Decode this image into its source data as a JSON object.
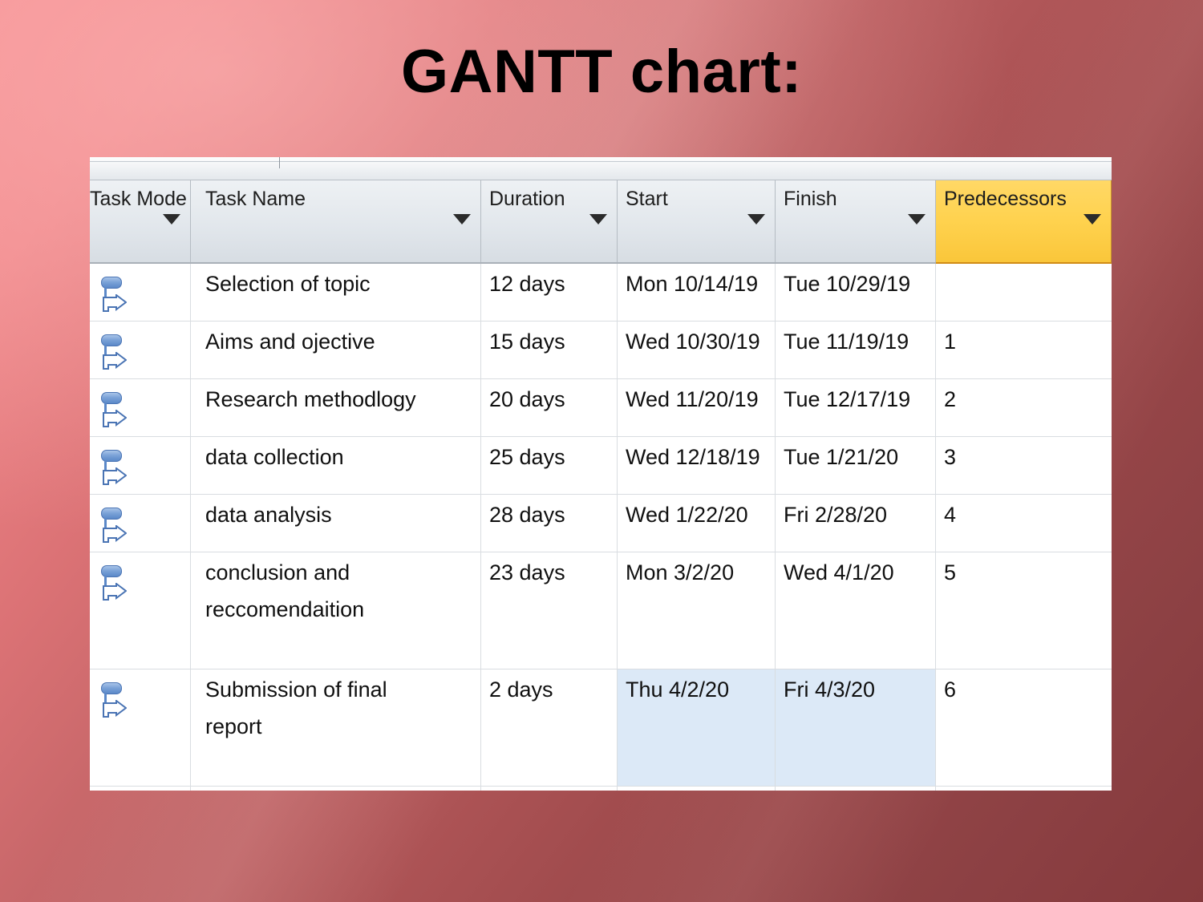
{
  "slide": {
    "title": "GANTT chart:",
    "background_light": "#f4898c",
    "background_dark": "#85393c"
  },
  "grid": {
    "columns": [
      {
        "key": "task_mode",
        "label": "Task Mode",
        "highlighted": false
      },
      {
        "key": "task_name",
        "label": "Task Name",
        "highlighted": false
      },
      {
        "key": "duration",
        "label": "Duration",
        "highlighted": false
      },
      {
        "key": "start",
        "label": "Start",
        "highlighted": false
      },
      {
        "key": "finish",
        "label": "Finish",
        "highlighted": false
      },
      {
        "key": "predecessors",
        "label": "Predecessors",
        "highlighted": true
      }
    ],
    "header_highlight_color": "#ffd24e",
    "selection_color": "#dce9f7",
    "mode_icon": "manually-scheduled-icon",
    "rows": [
      {
        "task_name": "Selection of topic",
        "duration": "12 days",
        "start": "Mon 10/14/19",
        "finish": "Tue 10/29/19",
        "predecessors": ""
      },
      {
        "task_name": "Aims and ojective",
        "duration": "15 days",
        "start": "Wed 10/30/19",
        "finish": "Tue 11/19/19",
        "predecessors": "1"
      },
      {
        "task_name": "Research methodlogy",
        "duration": "20 days",
        "start": "Wed 11/20/19",
        "finish": "Tue 12/17/19",
        "predecessors": "2"
      },
      {
        "task_name": "data collection",
        "duration": "25 days",
        "start": "Wed 12/18/19",
        "finish": "Tue 1/21/20",
        "predecessors": "3"
      },
      {
        "task_name": "data analysis",
        "duration": "28 days",
        "start": "Wed 1/22/20",
        "finish": "Fri 2/28/20",
        "predecessors": "4"
      },
      {
        "task_name_line1": "conclusion and",
        "task_name_line2": "reccomendaition",
        "duration": "23 days",
        "start": "Mon 3/2/20",
        "finish": "Wed 4/1/20",
        "predecessors": "5"
      },
      {
        "task_name_line1": "Submission of final",
        "task_name_line2": "report",
        "duration": "2 days",
        "start": "Thu 4/2/20",
        "finish": "Fri 4/3/20",
        "predecessors": "6"
      }
    ]
  },
  "chart_data": {
    "type": "table",
    "title": "GANTT chart:",
    "columns": [
      "Task Mode",
      "Task Name",
      "Duration",
      "Start",
      "Finish",
      "Predecessors"
    ],
    "rows": [
      [
        "Manually Scheduled",
        "Selection of topic",
        "12 days",
        "Mon 10/14/19",
        "Tue 10/29/19",
        ""
      ],
      [
        "Manually Scheduled",
        "Aims and ojective",
        "15 days",
        "Wed 10/30/19",
        "Tue 11/19/19",
        "1"
      ],
      [
        "Manually Scheduled",
        "Research methodlogy",
        "20 days",
        "Wed 11/20/19",
        "Tue 12/17/19",
        "2"
      ],
      [
        "Manually Scheduled",
        "data collection",
        "25 days",
        "Wed 12/18/19",
        "Tue 1/21/20",
        "3"
      ],
      [
        "Manually Scheduled",
        "data analysis",
        "28 days",
        "Wed 1/22/20",
        "Fri 2/28/20",
        "4"
      ],
      [
        "Manually Scheduled",
        "conclusion and reccomendaition",
        "23 days",
        "Mon 3/2/20",
        "Wed 4/1/20",
        "5"
      ],
      [
        "Manually Scheduled",
        "Submission of final report",
        "2 days",
        "Thu 4/2/20",
        "Fri 4/3/20",
        "6"
      ]
    ],
    "durations_days": [
      12,
      15,
      20,
      25,
      28,
      23,
      2
    ],
    "task_names": [
      "Selection of topic",
      "Aims and ojective",
      "Research methodlogy",
      "data collection",
      "data analysis",
      "conclusion and reccomendaition",
      "Submission of final report"
    ],
    "start_dates": [
      "Mon 10/14/19",
      "Wed 10/30/19",
      "Wed 11/20/19",
      "Wed 12/18/19",
      "Wed 1/22/20",
      "Mon 3/2/20",
      "Thu 4/2/20"
    ],
    "finish_dates": [
      "Tue 10/29/19",
      "Tue 11/19/19",
      "Tue 12/17/19",
      "Tue 1/21/20",
      "Fri 2/28/20",
      "Wed 4/1/20",
      "Fri 4/3/20"
    ],
    "predecessors": [
      "",
      "1",
      "2",
      "3",
      "4",
      "5",
      "6"
    ]
  }
}
